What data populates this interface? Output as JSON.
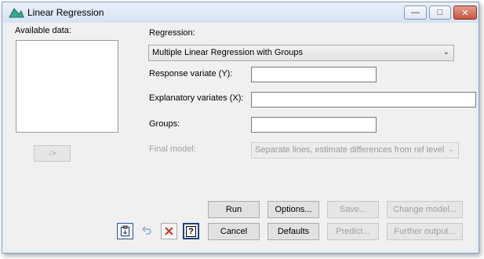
{
  "window": {
    "title": "Linear Regression"
  },
  "labels": {
    "available_data": "Available data:",
    "regression": "Regression:",
    "response": "Response variate (Y):",
    "explanatory": "Explanatory variates (X):",
    "groups": "Groups:",
    "final_model": "Final model:"
  },
  "regression_select": {
    "value": "Multiple Linear Regression with Groups"
  },
  "final_model_select": {
    "value": "Separate lines, estimate differences from ref level"
  },
  "fields": {
    "response": "",
    "explanatory": "",
    "groups": ""
  },
  "buttons": {
    "add": "->",
    "run": "Run",
    "options": "Options...",
    "save": "Save...",
    "change_model": "Change model...",
    "cancel": "Cancel",
    "defaults": "Defaults",
    "predict": "Predict...",
    "further_output": "Further output..."
  },
  "icons": {
    "app": "linear-regression-app-icon",
    "clipboard": "clipboard-icon",
    "undo": "undo-icon",
    "clear": "clear-x-icon",
    "help": "help-icon"
  },
  "colors": {
    "title_bar": "#d7e2f2",
    "dialog_bg": "#f0f0f0",
    "close_button": "#c8553d",
    "app_icon": "#3aa58a"
  }
}
